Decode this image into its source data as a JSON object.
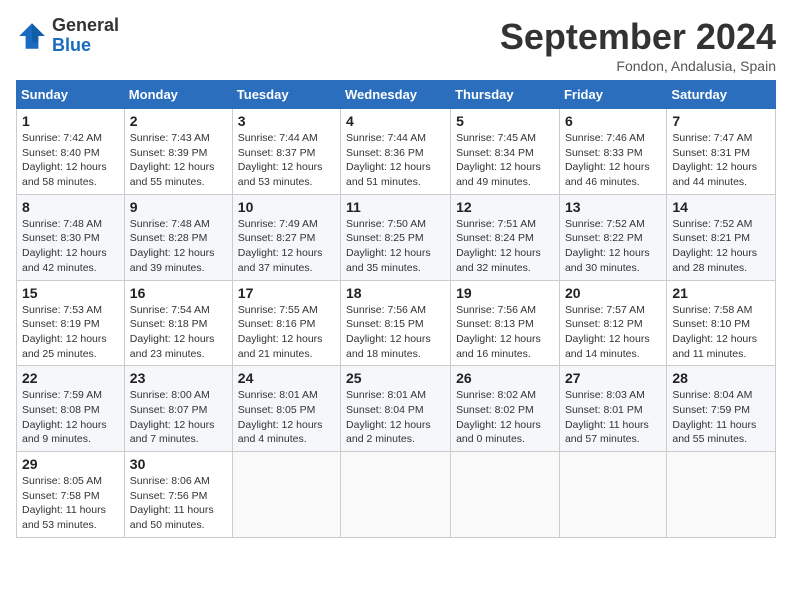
{
  "header": {
    "logo_general": "General",
    "logo_blue": "Blue",
    "month": "September 2024",
    "location": "Fondon, Andalusia, Spain"
  },
  "days_of_week": [
    "Sunday",
    "Monday",
    "Tuesday",
    "Wednesday",
    "Thursday",
    "Friday",
    "Saturday"
  ],
  "weeks": [
    [
      {
        "day": "1",
        "sunrise": "7:42 AM",
        "sunset": "8:40 PM",
        "daylight": "12 hours and 58 minutes."
      },
      {
        "day": "2",
        "sunrise": "7:43 AM",
        "sunset": "8:39 PM",
        "daylight": "12 hours and 55 minutes."
      },
      {
        "day": "3",
        "sunrise": "7:44 AM",
        "sunset": "8:37 PM",
        "daylight": "12 hours and 53 minutes."
      },
      {
        "day": "4",
        "sunrise": "7:44 AM",
        "sunset": "8:36 PM",
        "daylight": "12 hours and 51 minutes."
      },
      {
        "day": "5",
        "sunrise": "7:45 AM",
        "sunset": "8:34 PM",
        "daylight": "12 hours and 49 minutes."
      },
      {
        "day": "6",
        "sunrise": "7:46 AM",
        "sunset": "8:33 PM",
        "daylight": "12 hours and 46 minutes."
      },
      {
        "day": "7",
        "sunrise": "7:47 AM",
        "sunset": "8:31 PM",
        "daylight": "12 hours and 44 minutes."
      }
    ],
    [
      {
        "day": "8",
        "sunrise": "7:48 AM",
        "sunset": "8:30 PM",
        "daylight": "12 hours and 42 minutes."
      },
      {
        "day": "9",
        "sunrise": "7:48 AM",
        "sunset": "8:28 PM",
        "daylight": "12 hours and 39 minutes."
      },
      {
        "day": "10",
        "sunrise": "7:49 AM",
        "sunset": "8:27 PM",
        "daylight": "12 hours and 37 minutes."
      },
      {
        "day": "11",
        "sunrise": "7:50 AM",
        "sunset": "8:25 PM",
        "daylight": "12 hours and 35 minutes."
      },
      {
        "day": "12",
        "sunrise": "7:51 AM",
        "sunset": "8:24 PM",
        "daylight": "12 hours and 32 minutes."
      },
      {
        "day": "13",
        "sunrise": "7:52 AM",
        "sunset": "8:22 PM",
        "daylight": "12 hours and 30 minutes."
      },
      {
        "day": "14",
        "sunrise": "7:52 AM",
        "sunset": "8:21 PM",
        "daylight": "12 hours and 28 minutes."
      }
    ],
    [
      {
        "day": "15",
        "sunrise": "7:53 AM",
        "sunset": "8:19 PM",
        "daylight": "12 hours and 25 minutes."
      },
      {
        "day": "16",
        "sunrise": "7:54 AM",
        "sunset": "8:18 PM",
        "daylight": "12 hours and 23 minutes."
      },
      {
        "day": "17",
        "sunrise": "7:55 AM",
        "sunset": "8:16 PM",
        "daylight": "12 hours and 21 minutes."
      },
      {
        "day": "18",
        "sunrise": "7:56 AM",
        "sunset": "8:15 PM",
        "daylight": "12 hours and 18 minutes."
      },
      {
        "day": "19",
        "sunrise": "7:56 AM",
        "sunset": "8:13 PM",
        "daylight": "12 hours and 16 minutes."
      },
      {
        "day": "20",
        "sunrise": "7:57 AM",
        "sunset": "8:12 PM",
        "daylight": "12 hours and 14 minutes."
      },
      {
        "day": "21",
        "sunrise": "7:58 AM",
        "sunset": "8:10 PM",
        "daylight": "12 hours and 11 minutes."
      }
    ],
    [
      {
        "day": "22",
        "sunrise": "7:59 AM",
        "sunset": "8:08 PM",
        "daylight": "12 hours and 9 minutes."
      },
      {
        "day": "23",
        "sunrise": "8:00 AM",
        "sunset": "8:07 PM",
        "daylight": "12 hours and 7 minutes."
      },
      {
        "day": "24",
        "sunrise": "8:01 AM",
        "sunset": "8:05 PM",
        "daylight": "12 hours and 4 minutes."
      },
      {
        "day": "25",
        "sunrise": "8:01 AM",
        "sunset": "8:04 PM",
        "daylight": "12 hours and 2 minutes."
      },
      {
        "day": "26",
        "sunrise": "8:02 AM",
        "sunset": "8:02 PM",
        "daylight": "12 hours and 0 minutes."
      },
      {
        "day": "27",
        "sunrise": "8:03 AM",
        "sunset": "8:01 PM",
        "daylight": "11 hours and 57 minutes."
      },
      {
        "day": "28",
        "sunrise": "8:04 AM",
        "sunset": "7:59 PM",
        "daylight": "11 hours and 55 minutes."
      }
    ],
    [
      {
        "day": "29",
        "sunrise": "8:05 AM",
        "sunset": "7:58 PM",
        "daylight": "11 hours and 53 minutes."
      },
      {
        "day": "30",
        "sunrise": "8:06 AM",
        "sunset": "7:56 PM",
        "daylight": "11 hours and 50 minutes."
      },
      null,
      null,
      null,
      null,
      null
    ]
  ]
}
